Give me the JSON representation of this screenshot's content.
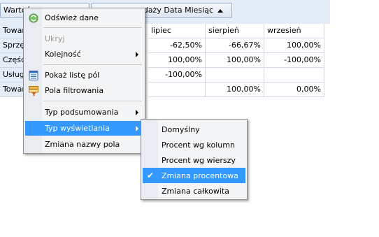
{
  "header": {
    "field1_label": "Wartoś",
    "field2_label": "zedaży Data Miesiąc"
  },
  "pivot": {
    "row_header_title": "Towar",
    "columns": [
      "lipiec",
      "sierpień",
      "wrzesień"
    ],
    "rows": [
      {
        "label": "Sprzęt",
        "values": [
          "-62,50%",
          "-66,67%",
          "100,00%"
        ]
      },
      {
        "label": "Części",
        "values": [
          "100,00%",
          "100,00%",
          "-100,00%"
        ]
      },
      {
        "label": "Usługi",
        "values": [
          "-100,00%",
          "",
          ""
        ]
      },
      {
        "label": "Towary",
        "values": [
          "",
          "100,00%",
          "0,00%"
        ]
      }
    ]
  },
  "context_menu": {
    "items": [
      {
        "label": "Odśwież dane",
        "icon": "refresh-icon"
      },
      {
        "label": "Ukryj",
        "disabled": true
      },
      {
        "label": "Kolejność",
        "submenu": true
      },
      {
        "label": "Pokaż listę pól",
        "icon": "field-list-icon"
      },
      {
        "label": "Pola filtrowania",
        "icon": "filter-icon"
      },
      {
        "label": "Typ podsumowania",
        "submenu": true
      },
      {
        "label": "Typ wyświetlania",
        "submenu": true,
        "highlighted": true
      },
      {
        "label": "Zmiana nazwy pola"
      }
    ]
  },
  "display_type_submenu": {
    "items": [
      {
        "label": "Domyślny"
      },
      {
        "label": "Procent wg kolumn"
      },
      {
        "label": "Procent wg wierszy"
      },
      {
        "label": "Zmiana procentowa",
        "checked": true,
        "highlighted": true
      },
      {
        "label": "Zmiana całkowita"
      }
    ]
  },
  "colors": {
    "highlight": "#3399ff",
    "header_bg": "#e4ecf7"
  }
}
